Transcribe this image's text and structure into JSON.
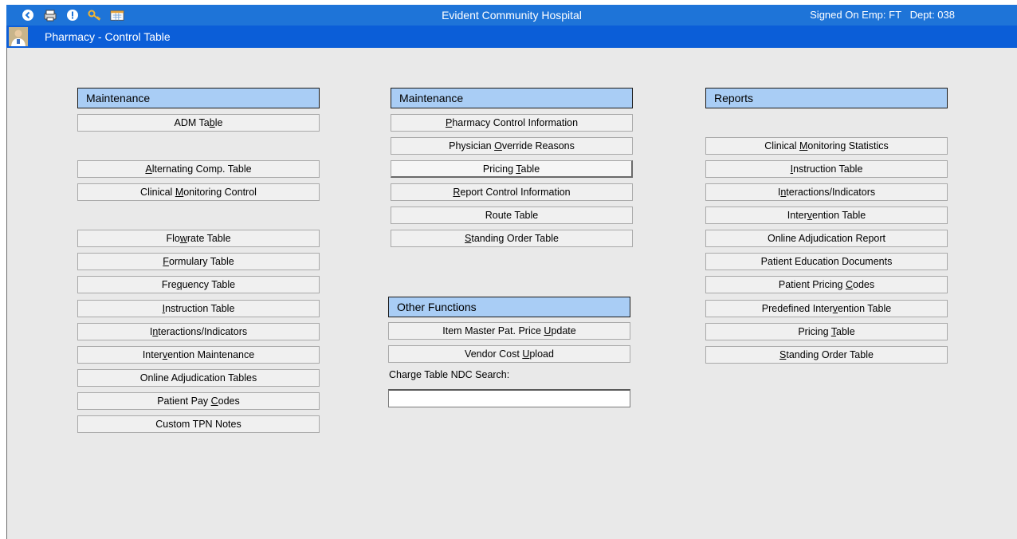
{
  "window": {
    "app_title": "Evident Community Hospital",
    "signon": "Signed On Emp: FT   Dept: 038",
    "toolbar_icons": [
      "back-icon",
      "printer-icon",
      "info-icon",
      "key-icon",
      "calendar-icon"
    ],
    "page_title": "Pharmacy - Control Table"
  },
  "left_column": {
    "header": "Maintenance",
    "buttons": [
      {
        "pre": "ADM Ta",
        "u": "b",
        "post": "le"
      },
      {
        "pre": "",
        "u": "A",
        "post": "lternating Comp. Table"
      },
      {
        "pre": "Clinical ",
        "u": "M",
        "post": "onitoring Control"
      },
      {
        "pre": "Flo",
        "u": "w",
        "post": "rate Table"
      },
      {
        "pre": "",
        "u": "F",
        "post": "ormulary Table"
      },
      {
        "pre": "Fre",
        "u": "q",
        "post": "uency Table"
      },
      {
        "pre": "",
        "u": "I",
        "post": "nstruction Table"
      },
      {
        "pre": "I",
        "u": "n",
        "post": "teractions/Indicators"
      },
      {
        "pre": "Inter",
        "u": "v",
        "post": "ention Maintenance"
      },
      {
        "pre": "Online Ad",
        "u": "j",
        "post": "udication Tables"
      },
      {
        "pre": "Patient Pay ",
        "u": "C",
        "post": "odes"
      },
      {
        "pre": "Custom TPN Notes",
        "u": "",
        "post": ""
      }
    ]
  },
  "middle_column": {
    "header": "Maintenance",
    "buttons": [
      {
        "pre": "",
        "u": "P",
        "post": "harmacy Control Information"
      },
      {
        "pre": "Physician ",
        "u": "O",
        "post": "verride Reasons"
      },
      {
        "pre": "Pricing ",
        "u": "T",
        "post": "able"
      },
      {
        "pre": "",
        "u": "R",
        "post": "eport Control Information"
      },
      {
        "pre": "Route Table",
        "u": "",
        "post": ""
      },
      {
        "pre": "",
        "u": "S",
        "post": "tanding Order Table"
      }
    ],
    "other_header": "Other Functions",
    "other_buttons": [
      {
        "pre": "Item Master Pat. Price ",
        "u": "U",
        "post": "pdate"
      },
      {
        "pre": "Vendor Cost ",
        "u": "U",
        "post": "pload"
      }
    ],
    "ndc_label": "Charge Table NDC Search:",
    "ndc_value": ""
  },
  "right_column": {
    "header": "Reports",
    "buttons": [
      {
        "pre": "Clinical ",
        "u": "M",
        "post": "onitoring Statistics"
      },
      {
        "pre": "",
        "u": "I",
        "post": "nstruction Table"
      },
      {
        "pre": "I",
        "u": "n",
        "post": "teractions/Indicators"
      },
      {
        "pre": "Inter",
        "u": "v",
        "post": "ention Table"
      },
      {
        "pre": "Online Adjudication Report",
        "u": "",
        "post": ""
      },
      {
        "pre": "Patient Education Documents",
        "u": "",
        "post": ""
      },
      {
        "pre": "Patient Pricing ",
        "u": "C",
        "post": "odes"
      },
      {
        "pre": "Predefined Inter",
        "u": "v",
        "post": "ention Table"
      },
      {
        "pre": "Pricing ",
        "u": "T",
        "post": "able"
      },
      {
        "pre": "",
        "u": "S",
        "post": "tanding Order Table"
      }
    ]
  }
}
